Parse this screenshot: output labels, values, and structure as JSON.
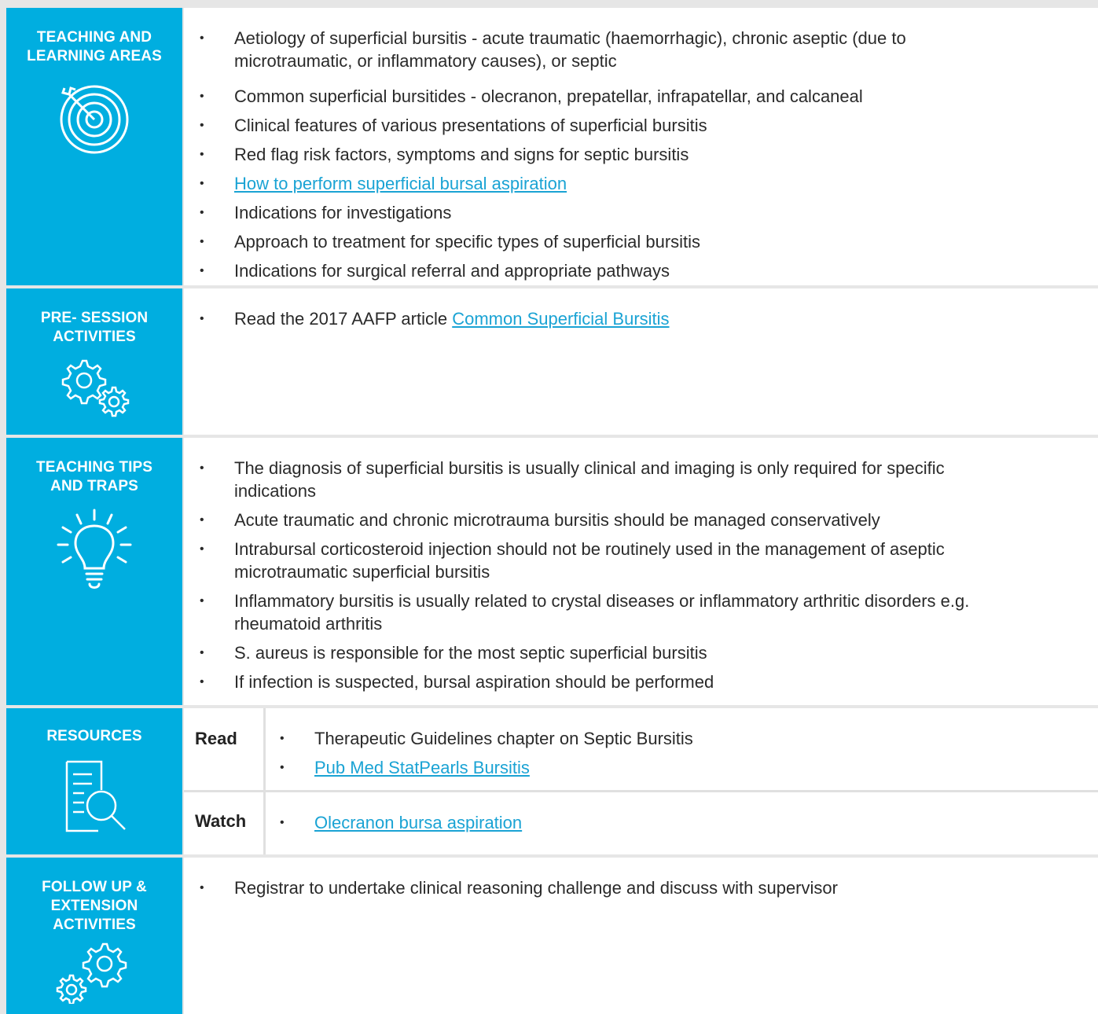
{
  "sections": {
    "teaching": {
      "title_line1": "TEACHING AND",
      "title_line2": "LEARNING AREAS",
      "icon": "target-icon",
      "items": [
        {
          "line1": "Aetiology of superficial bursitis - acute traumatic (haemorrhagic), chronic aseptic (due to",
          "line2": "microtraumatic, or inflammatory causes), or septic"
        },
        {
          "line1": "Common superficial bursitides - olecranon, prepatellar, infrapatellar, and calcaneal"
        },
        {
          "line1": "Clinical features of various presentations of superficial bursitis"
        },
        {
          "line1": "Red flag risk factors, symptoms and signs for septic bursitis"
        },
        {
          "link": "How to perform superficial bursal aspiration"
        },
        {
          "line1": "Indications for investigations"
        },
        {
          "line1": "Approach to treatment for specific types of superficial bursitis"
        },
        {
          "line1": "Indications for surgical referral and appropriate pathways"
        }
      ]
    },
    "presession": {
      "title_line1": "PRE- SESSION",
      "title_line2": "ACTIVITIES",
      "icon": "gears-icon",
      "item_prefix": "Read the 2017 AAFP article ",
      "item_link": "Common Superficial Bursitis"
    },
    "tips": {
      "title_line1": "TEACHING TIPS",
      "title_line2": "AND TRAPS",
      "icon": "lightbulb-icon",
      "items": [
        {
          "line1": "The diagnosis of superficial bursitis is usually clinical and imaging is only required for specific",
          "line2": "indications"
        },
        {
          "line1": "Acute traumatic and chronic microtrauma bursitis should be managed conservatively"
        },
        {
          "line1": "Intrabursal corticosteroid injection should not be routinely used in the management of aseptic",
          "line2": "microtraumatic superficial bursitis"
        },
        {
          "line1": "Inflammatory bursitis is usually related to crystal diseases or inflammatory arthritic disorders e.g.",
          "line2": "rheumatoid arthritis"
        },
        {
          "line1": "S. aureus is responsible for the most septic superficial bursitis"
        },
        {
          "line1": "If infection is suspected, bursal aspiration should be performed"
        }
      ]
    },
    "resources": {
      "title": "RESOURCES",
      "icon": "document-search-icon",
      "read_label": "Read",
      "read_item1": "Therapeutic Guidelines chapter on Septic Bursitis",
      "read_item2_link": "Pub Med StatPearls Bursitis",
      "watch_label": "Watch",
      "watch_item_link": "Olecranon bursa aspiration"
    },
    "followup": {
      "title_line1": "FOLLOW UP &",
      "title_line2": "EXTENSION",
      "title_line3": "ACTIVITIES",
      "icon": "gears-icon",
      "item": "Registrar to undertake clinical reasoning challenge and discuss with supervisor"
    }
  },
  "bullet": "•",
  "colors": {
    "accent": "#00aee0",
    "link": "#1aa3d4",
    "background": "#e6e6e6"
  }
}
